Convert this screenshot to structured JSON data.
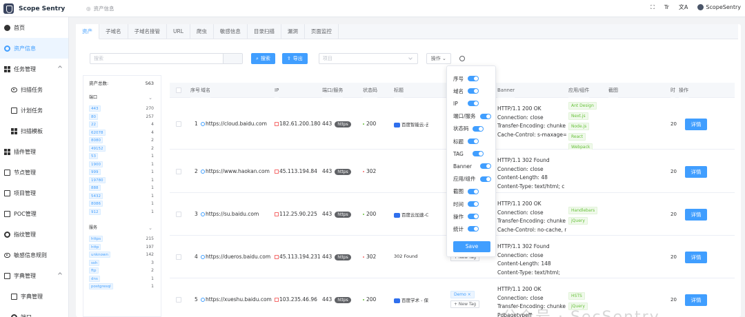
{
  "app": {
    "title": "Scope Sentry",
    "user": "ScopeSentry"
  },
  "breadcrumb": "资产信息",
  "header_tools": {
    "text_size_icon": "Tr",
    "translate_icon": "文A"
  },
  "sidebar": {
    "items": [
      {
        "label": "首页",
        "icon": "dashboard-icon",
        "active": false,
        "sub": false,
        "caret": false
      },
      {
        "label": "资产信息",
        "icon": "asset-icon",
        "active": true,
        "sub": false,
        "caret": false
      },
      {
        "label": "任务管理",
        "icon": "task-icon",
        "active": false,
        "sub": false,
        "caret": true
      },
      {
        "label": "扫描任务",
        "icon": "eye-icon",
        "active": false,
        "sub": true,
        "caret": false
      },
      {
        "label": "计划任务",
        "icon": "calendar-icon",
        "active": false,
        "sub": true,
        "caret": false
      },
      {
        "label": "扫描模板",
        "icon": "template-icon",
        "active": false,
        "sub": true,
        "caret": false
      },
      {
        "label": "插件管理",
        "icon": "plugin-icon",
        "active": false,
        "sub": false,
        "caret": false
      },
      {
        "label": "节点管理",
        "icon": "node-icon",
        "active": false,
        "sub": false,
        "caret": false
      },
      {
        "label": "项目管理",
        "icon": "project-icon",
        "active": false,
        "sub": false,
        "caret": false
      },
      {
        "label": "POC管理",
        "icon": "poc-icon",
        "active": false,
        "sub": false,
        "caret": false
      },
      {
        "label": "指纹管理",
        "icon": "fingerprint-icon",
        "active": false,
        "sub": false,
        "caret": false
      },
      {
        "label": "敏感信息规则",
        "icon": "sensitive-icon",
        "active": false,
        "sub": false,
        "caret": false
      },
      {
        "label": "字典管理",
        "icon": "dict-icon",
        "active": false,
        "sub": false,
        "caret": true
      },
      {
        "label": "字典管理",
        "icon": "dict-file-icon",
        "active": false,
        "sub": true,
        "caret": false
      },
      {
        "label": "端口",
        "icon": "port-icon",
        "active": false,
        "sub": true,
        "caret": false
      }
    ]
  },
  "tabs": [
    "资产",
    "子域名",
    "子域名接管",
    "URL",
    "爬虫",
    "敏感信息",
    "目录扫描",
    "漏洞",
    "页面监控"
  ],
  "toolbar": {
    "search_placeholder": "搜索",
    "search_button": "搜索",
    "export_button": "导出",
    "project_placeholder": "项目",
    "operation_button": "操作"
  },
  "stats": {
    "total_label": "资产总数:",
    "total_value": "563",
    "port_label": "端口",
    "ports": [
      [
        "443",
        "270"
      ],
      [
        "80",
        "257"
      ],
      [
        "22",
        "4"
      ],
      [
        "62078",
        "4"
      ],
      [
        "8080",
        "2"
      ],
      [
        "49152",
        "2"
      ],
      [
        "53",
        "1"
      ],
      [
        "1900",
        "1"
      ],
      [
        "999",
        "1"
      ],
      [
        "19780",
        "1"
      ],
      [
        "888",
        "1"
      ],
      [
        "5432",
        "1"
      ],
      [
        "8086",
        "1"
      ],
      [
        "912",
        "1"
      ]
    ],
    "service_label": "服务",
    "services": [
      [
        "https",
        "215"
      ],
      [
        "http",
        "197"
      ],
      [
        "unknown",
        "142"
      ],
      [
        "ssh",
        "3"
      ],
      [
        "ftp",
        "2"
      ],
      [
        "dns",
        "1"
      ],
      [
        "postgresql",
        "1"
      ]
    ]
  },
  "table": {
    "headers": {
      "index": "序号",
      "domain": "域名",
      "ip": "IP",
      "port": "端口/服务",
      "status": "状态码",
      "title": "标题",
      "banner": "Banner",
      "components": "应用/组件",
      "screenshot": "截图",
      "time": "时",
      "action": "操作"
    },
    "detail_label": "详情",
    "new_tag_label": "+ New Tag",
    "rows": [
      {
        "index": "1",
        "domain": "https://cloud.baidu.com",
        "ip": "182.61.200.180",
        "port": "443",
        "service": "https",
        "status": "200",
        "status_color": "#67c23a",
        "title": "百度智能云-云...",
        "favicon": "#2f6fed",
        "banner": "HTTP/1.1 200 OK\nConnection: close\nTransfer-Encoding: chunke\nCache-Control: s-maxage=",
        "components": [
          "Ant Design",
          "Next.js",
          "Node.js",
          "React",
          "Webpack"
        ],
        "time": "20",
        "tags": []
      },
      {
        "index": "2",
        "domain": "https://www.haokan.com",
        "ip": "45.113.194.84",
        "port": "443",
        "service": "https",
        "status": "302",
        "status_color": "#f56c6c",
        "title": "",
        "favicon": "",
        "banner": "HTTP/1.1 302 Found\nConnection: close\nContent-Length: 48\nContent-Type: text/html; c",
        "components": [],
        "time": "20",
        "tags": []
      },
      {
        "index": "3",
        "domain": "https://su.baidu.com",
        "ip": "112.25.90.225",
        "port": "443",
        "service": "https",
        "status": "200",
        "status_color": "#67c23a",
        "title": "百度云加速-C...",
        "favicon": "#2f6fed",
        "banner": "HTTP/1.1 200 OK\nConnection: close\nTransfer-Encoding: chunke\nCache-Control: no-cache, n",
        "components": [
          "Handlebars",
          "jQuery"
        ],
        "time": "20",
        "tags": []
      },
      {
        "index": "4",
        "domain": "https://dueros.baidu.com",
        "ip": "45.113.194.231",
        "port": "443",
        "service": "https",
        "status": "302",
        "status_color": "#f56c6c",
        "title": "302 Found",
        "favicon": "",
        "banner": "HTTP/1.1 302 Found\nConnection: close\nContent-Length: 148\nContent-Type: text/html;",
        "components": [],
        "time": "20",
        "tags": []
      },
      {
        "index": "5",
        "domain": "https://xueshu.baidu.com",
        "ip": "103.235.46.96",
        "port": "443",
        "service": "https",
        "status": "200",
        "status_color": "#67c23a",
        "title": "百度学术 - 保...",
        "favicon": "#2f6fed",
        "banner": "HTTP/1.1 200 OK\nConnection: close\nTransfer-Encoding: chunke\nPdbagetypeff",
        "components": [
          "HSTS",
          "jQuery"
        ],
        "time": "20",
        "tags": [
          "Demo ×"
        ]
      }
    ]
  },
  "column_popover": {
    "items": [
      "序号",
      "域名",
      "IP",
      "端口/服务",
      "状态码",
      "标题",
      "TAG",
      "Banner",
      "应用/组件",
      "截图",
      "时间",
      "操作",
      "统计"
    ],
    "save_label": "Save"
  },
  "watermark": "公众号 · SecSentry",
  "colors": {
    "accent": "#409eff",
    "success": "#67c23a",
    "danger": "#f56c6c"
  }
}
